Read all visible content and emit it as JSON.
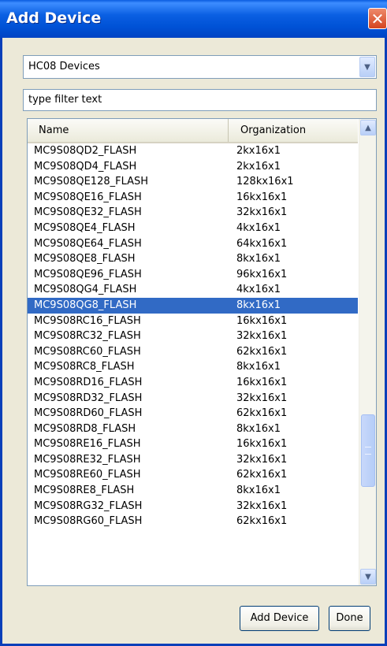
{
  "window": {
    "title": "Add Device",
    "close_symbol": "✕"
  },
  "combo": {
    "selected": "HC08 Devices"
  },
  "filter": {
    "placeholder": "type filter text"
  },
  "table": {
    "columns": [
      "Name",
      "Organization"
    ],
    "rows": [
      {
        "name": "MC9S08QD2_FLASH",
        "org": "2kx16x1"
      },
      {
        "name": "MC9S08QD4_FLASH",
        "org": "2kx16x1"
      },
      {
        "name": "MC9S08QE128_FLASH",
        "org": "128kx16x1"
      },
      {
        "name": "MC9S08QE16_FLASH",
        "org": "16kx16x1"
      },
      {
        "name": "MC9S08QE32_FLASH",
        "org": "32kx16x1"
      },
      {
        "name": "MC9S08QE4_FLASH",
        "org": "4kx16x1"
      },
      {
        "name": "MC9S08QE64_FLASH",
        "org": "64kx16x1"
      },
      {
        "name": "MC9S08QE8_FLASH",
        "org": "8kx16x1"
      },
      {
        "name": "MC9S08QE96_FLASH",
        "org": "96kx16x1"
      },
      {
        "name": "MC9S08QG4_FLASH",
        "org": "4kx16x1"
      },
      {
        "name": "MC9S08QG8_FLASH",
        "org": "8kx16x1",
        "selected": true
      },
      {
        "name": "MC9S08RC16_FLASH",
        "org": "16kx16x1"
      },
      {
        "name": "MC9S08RC32_FLASH",
        "org": "32kx16x1"
      },
      {
        "name": "MC9S08RC60_FLASH",
        "org": "62kx16x1"
      },
      {
        "name": "MC9S08RC8_FLASH",
        "org": "8kx16x1"
      },
      {
        "name": "MC9S08RD16_FLASH",
        "org": "16kx16x1"
      },
      {
        "name": "MC9S08RD32_FLASH",
        "org": "32kx16x1"
      },
      {
        "name": "MC9S08RD60_FLASH",
        "org": "62kx16x1"
      },
      {
        "name": "MC9S08RD8_FLASH",
        "org": "8kx16x1"
      },
      {
        "name": "MC9S08RE16_FLASH",
        "org": "16kx16x1"
      },
      {
        "name": "MC9S08RE32_FLASH",
        "org": "32kx16x1"
      },
      {
        "name": "MC9S08RE60_FLASH",
        "org": "62kx16x1"
      },
      {
        "name": "MC9S08RE8_FLASH",
        "org": "8kx16x1"
      },
      {
        "name": "MC9S08RG32_FLASH",
        "org": "32kx16x1"
      },
      {
        "name": "MC9S08RG60_FLASH",
        "org": "62kx16x1"
      }
    ]
  },
  "buttons": {
    "add_device": "Add Device",
    "done": "Done"
  },
  "colors": {
    "title_bar": "#0054e3",
    "selection": "#316ac5",
    "close": "#d4441f"
  }
}
